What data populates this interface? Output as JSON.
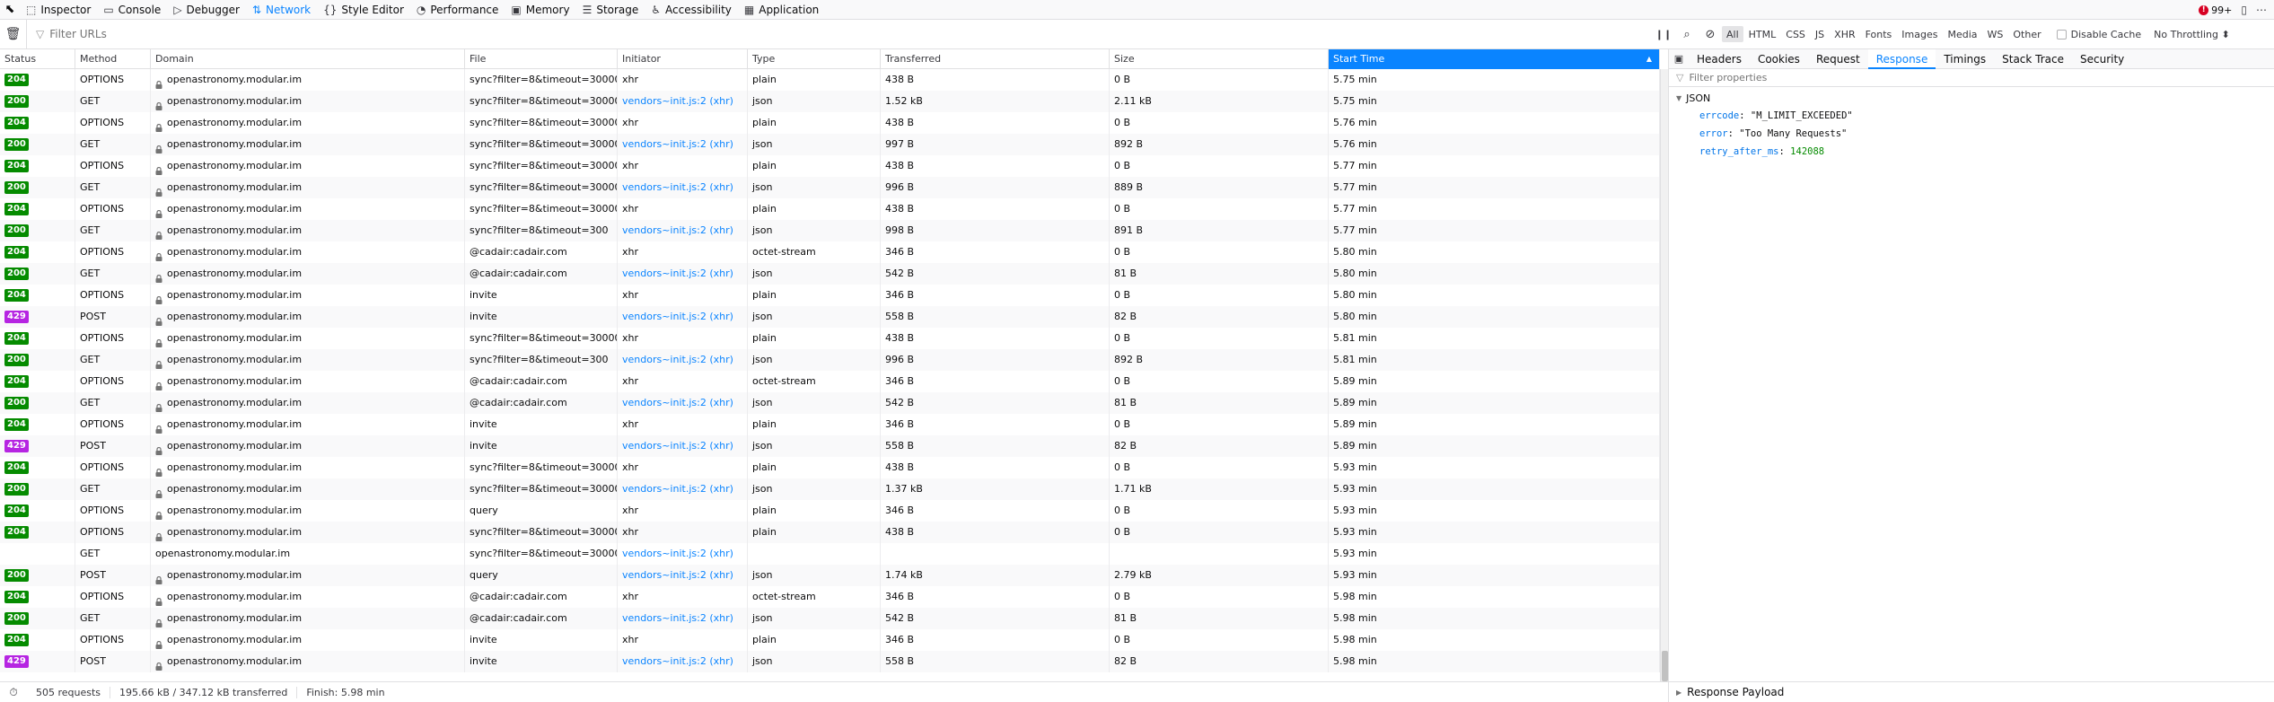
{
  "toolbox": {
    "tabs": [
      {
        "label": "Inspector",
        "icon": "inspector-icon",
        "glyph": "⬚",
        "active": false
      },
      {
        "label": "Console",
        "icon": "console-icon",
        "glyph": "▭",
        "active": false
      },
      {
        "label": "Debugger",
        "icon": "debugger-icon",
        "glyph": "▷",
        "active": false
      },
      {
        "label": "Network",
        "icon": "network-icon",
        "glyph": "⇅",
        "active": true
      },
      {
        "label": "Style Editor",
        "icon": "style-editor-icon",
        "glyph": "{}",
        "active": false
      },
      {
        "label": "Performance",
        "icon": "performance-icon",
        "glyph": "◔",
        "active": false
      },
      {
        "label": "Memory",
        "icon": "memory-icon",
        "glyph": "▣",
        "active": false
      },
      {
        "label": "Storage",
        "icon": "storage-icon",
        "glyph": "☰",
        "active": false
      },
      {
        "label": "Accessibility",
        "icon": "accessibility-icon",
        "glyph": "♿",
        "active": false
      },
      {
        "label": "Application",
        "icon": "application-icon",
        "glyph": "▦",
        "active": false
      }
    ],
    "error_count": "99+"
  },
  "net_toolbar": {
    "filter_placeholder": "Filter URLs",
    "type_filters": [
      {
        "label": "All",
        "active": true
      },
      {
        "label": "HTML",
        "active": false
      },
      {
        "label": "CSS",
        "active": false
      },
      {
        "label": "JS",
        "active": false
      },
      {
        "label": "XHR",
        "active": false
      },
      {
        "label": "Fonts",
        "active": false
      },
      {
        "label": "Images",
        "active": false
      },
      {
        "label": "Media",
        "active": false
      },
      {
        "label": "WS",
        "active": false
      },
      {
        "label": "Other",
        "active": false
      }
    ],
    "disable_cache_label": "Disable Cache",
    "throttling_label": "No Throttling ⬍"
  },
  "columns": {
    "status": "Status",
    "method": "Method",
    "domain": "Domain",
    "file": "File",
    "initiator": "Initiator",
    "type": "Type",
    "transferred": "Transferred",
    "size": "Size",
    "start_time": "Start Time"
  },
  "rows": [
    {
      "status": "204",
      "method": "OPTIONS",
      "domain": "openastronomy.modular.im",
      "secure": true,
      "file": "sync?filter=8&timeout=30000&s",
      "initiator": "xhr",
      "initiator_link": false,
      "type": "plain",
      "transferred": "438 B",
      "size": "0 B",
      "start": "5.75 min"
    },
    {
      "status": "200",
      "method": "GET",
      "domain": "openastronomy.modular.im",
      "secure": true,
      "file": "sync?filter=8&timeout=30000&s",
      "initiator": "vendors~init.js:2 (xhr)",
      "initiator_link": true,
      "type": "json",
      "transferred": "1.52 kB",
      "size": "2.11 kB",
      "start": "5.75 min"
    },
    {
      "status": "204",
      "method": "OPTIONS",
      "domain": "openastronomy.modular.im",
      "secure": true,
      "file": "sync?filter=8&timeout=30000&s",
      "initiator": "xhr",
      "initiator_link": false,
      "type": "plain",
      "transferred": "438 B",
      "size": "0 B",
      "start": "5.76 min"
    },
    {
      "status": "200",
      "method": "GET",
      "domain": "openastronomy.modular.im",
      "secure": true,
      "file": "sync?filter=8&timeout=30000&s",
      "initiator": "vendors~init.js:2 (xhr)",
      "initiator_link": true,
      "type": "json",
      "transferred": "997 B",
      "size": "892 B",
      "start": "5.76 min"
    },
    {
      "status": "204",
      "method": "OPTIONS",
      "domain": "openastronomy.modular.im",
      "secure": true,
      "file": "sync?filter=8&timeout=30000&s",
      "initiator": "xhr",
      "initiator_link": false,
      "type": "plain",
      "transferred": "438 B",
      "size": "0 B",
      "start": "5.77 min"
    },
    {
      "status": "200",
      "method": "GET",
      "domain": "openastronomy.modular.im",
      "secure": true,
      "file": "sync?filter=8&timeout=30000&s",
      "initiator": "vendors~init.js:2 (xhr)",
      "initiator_link": true,
      "type": "json",
      "transferred": "996 B",
      "size": "889 B",
      "start": "5.77 min"
    },
    {
      "status": "204",
      "method": "OPTIONS",
      "domain": "openastronomy.modular.im",
      "secure": true,
      "file": "sync?filter=8&timeout=30000&s",
      "initiator": "xhr",
      "initiator_link": false,
      "type": "plain",
      "transferred": "438 B",
      "size": "0 B",
      "start": "5.77 min"
    },
    {
      "status": "200",
      "method": "GET",
      "domain": "openastronomy.modular.im",
      "secure": true,
      "file": "sync?filter=8&timeout=300",
      "initiator": "vendors~init.js:2 (xhr)",
      "initiator_link": true,
      "type": "json",
      "transferred": "998 B",
      "size": "891 B",
      "start": "5.77 min"
    },
    {
      "status": "204",
      "method": "OPTIONS",
      "domain": "openastronomy.modular.im",
      "secure": true,
      "file": "@cadair:cadair.com",
      "initiator": "xhr",
      "initiator_link": false,
      "type": "octet-stream",
      "transferred": "346 B",
      "size": "0 B",
      "start": "5.80 min"
    },
    {
      "status": "200",
      "method": "GET",
      "domain": "openastronomy.modular.im",
      "secure": true,
      "file": "@cadair:cadair.com",
      "initiator": "vendors~init.js:2 (xhr)",
      "initiator_link": true,
      "type": "json",
      "transferred": "542 B",
      "size": "81 B",
      "start": "5.80 min"
    },
    {
      "status": "204",
      "method": "OPTIONS",
      "domain": "openastronomy.modular.im",
      "secure": true,
      "file": "invite",
      "initiator": "xhr",
      "initiator_link": false,
      "type": "plain",
      "transferred": "346 B",
      "size": "0 B",
      "start": "5.80 min"
    },
    {
      "status": "429",
      "method": "POST",
      "domain": "openastronomy.modular.im",
      "secure": true,
      "file": "invite",
      "initiator": "vendors~init.js:2 (xhr)",
      "initiator_link": true,
      "type": "json",
      "transferred": "558 B",
      "size": "82 B",
      "start": "5.80 min"
    },
    {
      "status": "204",
      "method": "OPTIONS",
      "domain": "openastronomy.modular.im",
      "secure": true,
      "file": "sync?filter=8&timeout=30000&s",
      "initiator": "xhr",
      "initiator_link": false,
      "type": "plain",
      "transferred": "438 B",
      "size": "0 B",
      "start": "5.81 min"
    },
    {
      "status": "200",
      "method": "GET",
      "domain": "openastronomy.modular.im",
      "secure": true,
      "file": "sync?filter=8&timeout=300",
      "initiator": "vendors~init.js:2 (xhr)",
      "initiator_link": true,
      "type": "json",
      "transferred": "996 B",
      "size": "892 B",
      "start": "5.81 min"
    },
    {
      "status": "204",
      "method": "OPTIONS",
      "domain": "openastronomy.modular.im",
      "secure": true,
      "file": "@cadair:cadair.com",
      "initiator": "xhr",
      "initiator_link": false,
      "type": "octet-stream",
      "transferred": "346 B",
      "size": "0 B",
      "start": "5.89 min"
    },
    {
      "status": "200",
      "method": "GET",
      "domain": "openastronomy.modular.im",
      "secure": true,
      "file": "@cadair:cadair.com",
      "initiator": "vendors~init.js:2 (xhr)",
      "initiator_link": true,
      "type": "json",
      "transferred": "542 B",
      "size": "81 B",
      "start": "5.89 min"
    },
    {
      "status": "204",
      "method": "OPTIONS",
      "domain": "openastronomy.modular.im",
      "secure": true,
      "file": "invite",
      "initiator": "xhr",
      "initiator_link": false,
      "type": "plain",
      "transferred": "346 B",
      "size": "0 B",
      "start": "5.89 min"
    },
    {
      "status": "429",
      "method": "POST",
      "domain": "openastronomy.modular.im",
      "secure": true,
      "file": "invite",
      "initiator": "vendors~init.js:2 (xhr)",
      "initiator_link": true,
      "type": "json",
      "transferred": "558 B",
      "size": "82 B",
      "start": "5.89 min"
    },
    {
      "status": "204",
      "method": "OPTIONS",
      "domain": "openastronomy.modular.im",
      "secure": true,
      "file": "sync?filter=8&timeout=30000&s",
      "initiator": "xhr",
      "initiator_link": false,
      "type": "plain",
      "transferred": "438 B",
      "size": "0 B",
      "start": "5.93 min"
    },
    {
      "status": "200",
      "method": "GET",
      "domain": "openastronomy.modular.im",
      "secure": true,
      "file": "sync?filter=8&timeout=30000&s",
      "initiator": "vendors~init.js:2 (xhr)",
      "initiator_link": true,
      "type": "json",
      "transferred": "1.37 kB",
      "size": "1.71 kB",
      "start": "5.93 min"
    },
    {
      "status": "204",
      "method": "OPTIONS",
      "domain": "openastronomy.modular.im",
      "secure": true,
      "file": "query",
      "initiator": "xhr",
      "initiator_link": false,
      "type": "plain",
      "transferred": "346 B",
      "size": "0 B",
      "start": "5.93 min"
    },
    {
      "status": "204",
      "method": "OPTIONS",
      "domain": "openastronomy.modular.im",
      "secure": true,
      "file": "sync?filter=8&timeout=30000&s",
      "initiator": "xhr",
      "initiator_link": false,
      "type": "plain",
      "transferred": "438 B",
      "size": "0 B",
      "start": "5.93 min"
    },
    {
      "status": "",
      "method": "GET",
      "domain": "openastronomy.modular.im",
      "secure": false,
      "file": "sync?filter=8&timeout=30000&s",
      "initiator": "vendors~init.js:2 (xhr)",
      "initiator_link": true,
      "type": "",
      "transferred": "",
      "size": "",
      "start": "5.93 min"
    },
    {
      "status": "200",
      "method": "POST",
      "domain": "openastronomy.modular.im",
      "secure": true,
      "file": "query",
      "initiator": "vendors~init.js:2 (xhr)",
      "initiator_link": true,
      "type": "json",
      "transferred": "1.74 kB",
      "size": "2.79 kB",
      "start": "5.93 min"
    },
    {
      "status": "204",
      "method": "OPTIONS",
      "domain": "openastronomy.modular.im",
      "secure": true,
      "file": "@cadair:cadair.com",
      "initiator": "xhr",
      "initiator_link": false,
      "type": "octet-stream",
      "transferred": "346 B",
      "size": "0 B",
      "start": "5.98 min"
    },
    {
      "status": "200",
      "method": "GET",
      "domain": "openastronomy.modular.im",
      "secure": true,
      "file": "@cadair:cadair.com",
      "initiator": "vendors~init.js:2 (xhr)",
      "initiator_link": true,
      "type": "json",
      "transferred": "542 B",
      "size": "81 B",
      "start": "5.98 min"
    },
    {
      "status": "204",
      "method": "OPTIONS",
      "domain": "openastronomy.modular.im",
      "secure": true,
      "file": "invite",
      "initiator": "xhr",
      "initiator_link": false,
      "type": "plain",
      "transferred": "346 B",
      "size": "0 B",
      "start": "5.98 min"
    },
    {
      "status": "429",
      "method": "POST",
      "domain": "openastronomy.modular.im",
      "secure": true,
      "file": "invite",
      "initiator": "vendors~init.js:2 (xhr)",
      "initiator_link": true,
      "type": "json",
      "transferred": "558 B",
      "size": "82 B",
      "start": "5.98 min"
    }
  ],
  "statusbar": {
    "requests": "505 requests",
    "transferred": "195.66 kB / 347.12 kB transferred",
    "finish": "Finish: 5.98 min"
  },
  "side_panel": {
    "tabs": [
      {
        "label": "Headers",
        "active": false
      },
      {
        "label": "Cookies",
        "active": false
      },
      {
        "label": "Request",
        "active": false
      },
      {
        "label": "Response",
        "active": true
      },
      {
        "label": "Timings",
        "active": false
      },
      {
        "label": "Stack Trace",
        "active": false
      },
      {
        "label": "Security",
        "active": false
      }
    ],
    "filter_placeholder": "Filter properties",
    "json_label": "JSON",
    "json": [
      {
        "key": "errcode",
        "value": "\"M_LIMIT_EXCEEDED\"",
        "kind": "str"
      },
      {
        "key": "error",
        "value": "\"Too Many Requests\"",
        "kind": "str"
      },
      {
        "key": "retry_after_ms",
        "value": "142088",
        "kind": "num"
      }
    ],
    "payload_label": "Response Payload"
  },
  "colors": {
    "accent": "#0a84ff",
    "status_ok": "#058b00",
    "status_429": "#b625e2",
    "error": "#d70022"
  }
}
